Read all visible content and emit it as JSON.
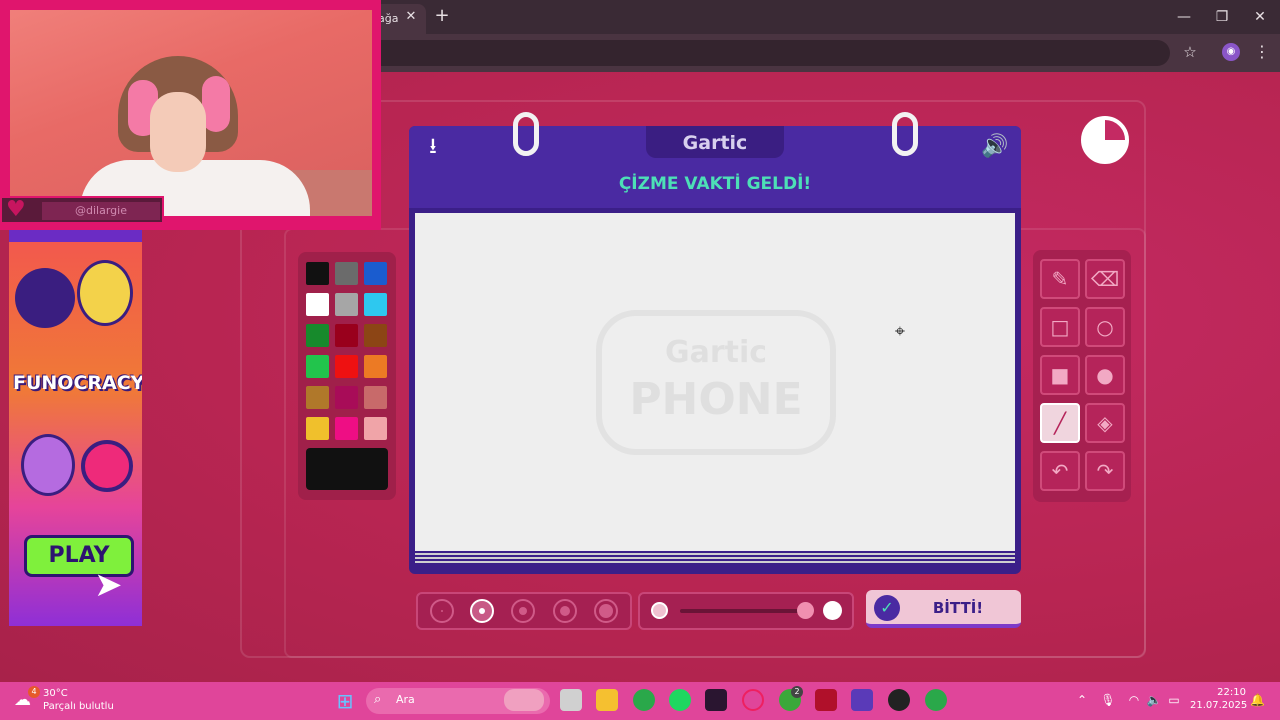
{
  "browser": {
    "tab_title": "ağa",
    "tab_close": "✕",
    "new_tab": "+",
    "minimize": "—",
    "restore": "❐",
    "close": "✕"
  },
  "stream": {
    "username": "@dilargie"
  },
  "ad": {
    "logo_text": "FUNOCRACY",
    "play_label": "PLAY"
  },
  "palette": {
    "colors": [
      "#111111",
      "#6b6b6b",
      "#1a5ccf",
      "#ffffff",
      "#a6a6a6",
      "#2ec8ef",
      "#178a2c",
      "#99001c",
      "#8c4515",
      "#22c44c",
      "#ee1111",
      "#ec7a24",
      "#b0782a",
      "#a80c58",
      "#c86a6a",
      "#f0c02c",
      "#ee0e84",
      "#f0a4a8"
    ],
    "current_color": "#111111"
  },
  "card": {
    "logo": "Gartic",
    "title": "ÇİZME VAKTİ GELDİ!",
    "watermark_top": "Gartic",
    "watermark_bottom": "PHONE"
  },
  "tools": {
    "pencil": "✎",
    "eraser": "⌫",
    "rect_outline": "□",
    "ellipse_outline": "○",
    "rect_fill": "■",
    "ellipse_fill": "●",
    "line": "╱",
    "fill_bucket": "◈",
    "undo": "↶",
    "redo": "↷"
  },
  "done_button": {
    "label": "BİTTİ!",
    "icon": "✓"
  },
  "taskbar": {
    "weather_temp": "30°C",
    "weather_desc": "Parçalı bulutlu",
    "weather_badge": "4",
    "search_placeholder": "Ara",
    "xbox_badge": "2",
    "time": "22:10",
    "date": "21.07.2025"
  }
}
